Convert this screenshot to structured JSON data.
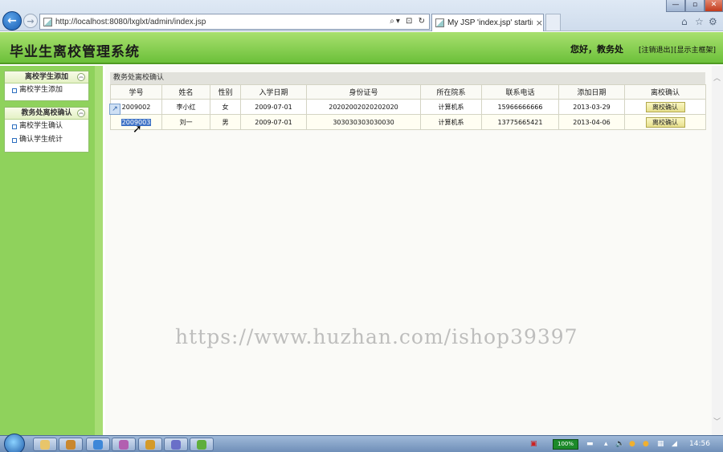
{
  "browser": {
    "url": "http://localhost:8080/lxglxt/admin/index.jsp",
    "tab_title": "My JSP 'index.jsp' startin...",
    "tab_close": "×"
  },
  "header": {
    "title": "毕业生离校管理系统",
    "greeting": "您好，教务处",
    "logout": "[注销退出]",
    "home": "[显示主框架]"
  },
  "sidebar": {
    "panel1": {
      "title": "离校学生添加",
      "items": [
        "离校学生添加"
      ]
    },
    "panel2": {
      "title": "教务处离校确认",
      "items": [
        "离校学生确认",
        "确认学生统计"
      ]
    }
  },
  "main": {
    "section_title": "教务处离校确认",
    "columns": [
      "学号",
      "姓名",
      "性别",
      "入学日期",
      "身份证号",
      "所在院系",
      "联系电话",
      "添加日期",
      "离校确认"
    ],
    "rows": [
      [
        "2009002",
        "李小红",
        "女",
        "2009-07-01",
        "20202002020202020",
        "计算机系",
        "15966666666",
        "2013-03-29",
        "离校确认"
      ],
      [
        "2009003",
        "刘一",
        "男",
        "2009-07-01",
        "303030303030030",
        "计算机系",
        "13775665421",
        "2013-04-06",
        "离校确认"
      ]
    ]
  },
  "watermark": "https://www.huzhan.com/ishop39397",
  "taskbar": {
    "battery": "100%",
    "clock": "14:56"
  },
  "colors": {
    "header_green": "#6cc03a",
    "sidebar_green": "#8fd25c",
    "selection_blue": "#3f73c6"
  }
}
